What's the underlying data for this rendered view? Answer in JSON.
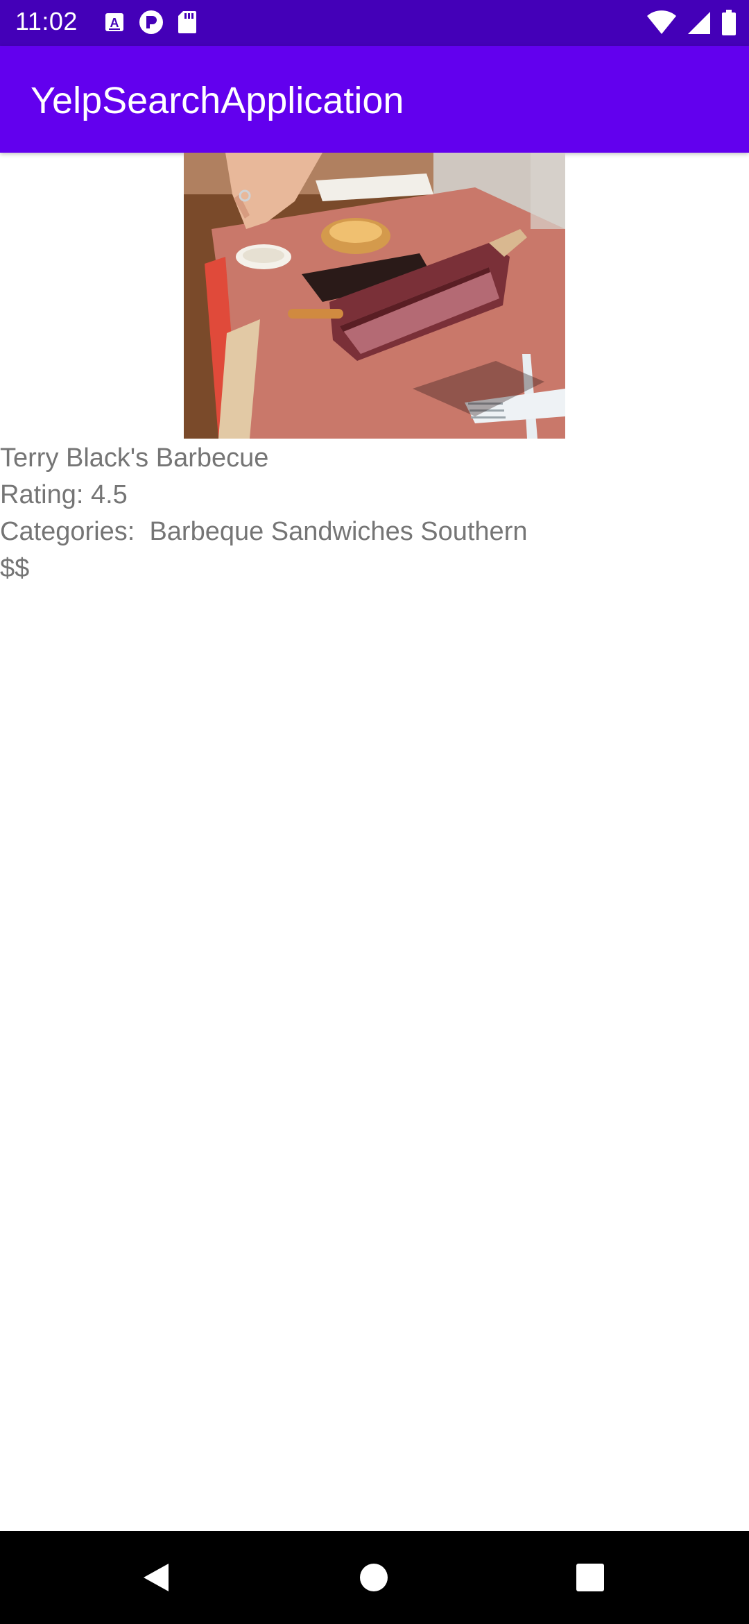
{
  "status_bar": {
    "time": "11:02",
    "left_icons": [
      "text-a-icon",
      "p-circle-icon",
      "sd-card-icon"
    ],
    "right_icons": [
      "wifi-icon",
      "signal-icon",
      "battery-icon"
    ],
    "background": "#4400b8"
  },
  "app_bar": {
    "title": "YelpSearchApplication",
    "background": "#6200ee"
  },
  "business": {
    "image_alt": "Beef rib barbecue on butcher paper tray",
    "name": "Terry Black's Barbecue",
    "rating": "Rating: 4.5",
    "categories": "Categories:  Barbeque Sandwiches Southern",
    "price": "$$"
  },
  "nav_bar": {
    "buttons": [
      "back-icon",
      "home-icon",
      "recents-icon"
    ]
  }
}
